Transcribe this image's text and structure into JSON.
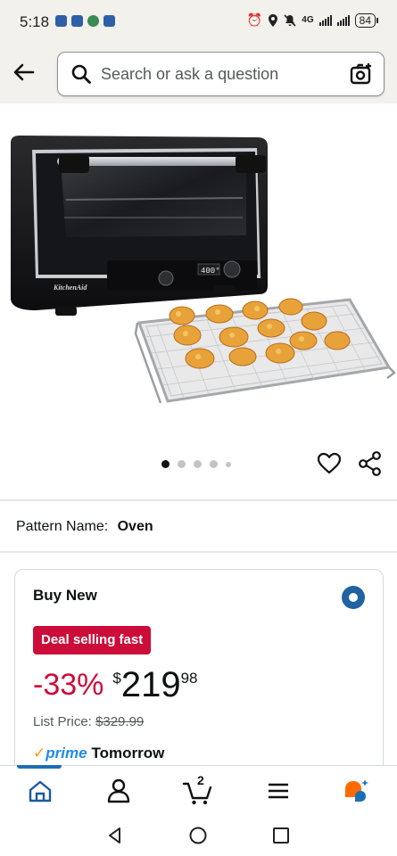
{
  "status_bar": {
    "time": "5:18",
    "network": "4G",
    "battery": "84"
  },
  "header": {
    "search_placeholder": "Search or ask a question"
  },
  "product": {
    "brand_mark": "KitchenAid",
    "oven_display": "400°",
    "carousel": {
      "dot_count": 5,
      "active_index": 0
    }
  },
  "pattern": {
    "label": "Pattern Name:",
    "value": "Oven"
  },
  "buy_box": {
    "title": "Buy New",
    "deal_badge": "Deal selling fast",
    "discount": "-33%",
    "currency": "$",
    "price_whole": "219",
    "price_fraction": "98",
    "list_price_label": "List Price:",
    "list_price_value": "$329.99",
    "prime_check": "✓",
    "prime_word": "prime",
    "delivery_day": "Tomorrow"
  },
  "bottom_nav": {
    "cart_count": "2",
    "active_item": "home"
  },
  "colors": {
    "deal_red": "#cc0c39",
    "radio_blue": "#2162a1",
    "prime_blue": "#1f8ce6",
    "prime_orange": "#ff9900",
    "header_bg": "#f2f1ec"
  }
}
